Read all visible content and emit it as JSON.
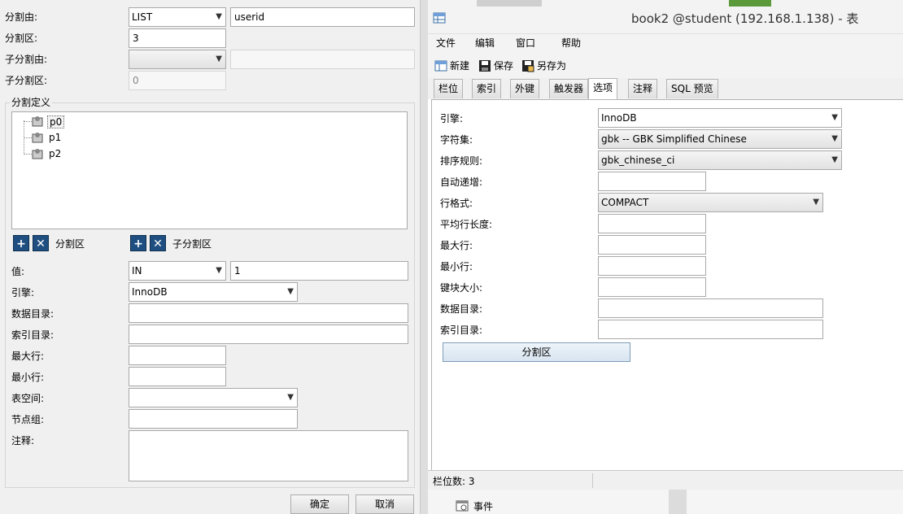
{
  "left": {
    "partition_by_label": "分割由:",
    "partition_by_value": "LIST",
    "partition_by_expr": "userid",
    "partitions_label": "分割区:",
    "partitions_value": "3",
    "subpartition_by_label": "子分割由:",
    "subpartition_by_value": "",
    "subpartition_expr": "",
    "subpartitions_label": "子分割区:",
    "subpartitions_value": "0",
    "definition_label": "分割定义",
    "tree_items": [
      "p0",
      "p1",
      "p2"
    ],
    "partition_group_label": "分割区",
    "subpartition_group_label": "子分割区",
    "value_label": "值:",
    "value_op": "IN",
    "value_expr": "1",
    "engine_label": "引擎:",
    "engine_value": "InnoDB",
    "data_dir_label": "数据目录:",
    "index_dir_label": "索引目录:",
    "max_rows_label": "最大行:",
    "min_rows_label": "最小行:",
    "tablespace_label": "表空间:",
    "nodegroup_label": "节点组:",
    "comment_label": "注释:",
    "ok_label": "确定",
    "cancel_label": "取消"
  },
  "window": {
    "title": "book2 @student (192.168.1.138) - 表",
    "menu": [
      "文件",
      "编辑",
      "窗口",
      "帮助"
    ],
    "toolbar": {
      "new_label": "新建",
      "save_label": "保存",
      "saveas_label": "另存为"
    },
    "tabs": [
      "栏位",
      "索引",
      "外键",
      "触发器",
      "选项",
      "注释",
      "SQL 预览"
    ],
    "active_tab": "选项",
    "options": {
      "engine_label": "引擎:",
      "engine_value": "InnoDB",
      "charset_label": "字符集:",
      "charset_value": "gbk -- GBK Simplified Chinese",
      "collation_label": "排序规则:",
      "collation_value": "gbk_chinese_ci",
      "auto_inc_label": "自动递增:",
      "row_format_label": "行格式:",
      "row_format_value": "COMPACT",
      "avg_row_label": "平均行长度:",
      "max_rows_label": "最大行:",
      "min_rows_label": "最小行:",
      "key_block_label": "键块大小:",
      "data_dir_label": "数据目录:",
      "index_dir_label": "索引目录:",
      "partition_button": "分割区"
    },
    "status": "栏位数: 3"
  },
  "bottom_tree": {
    "item": "事件"
  }
}
